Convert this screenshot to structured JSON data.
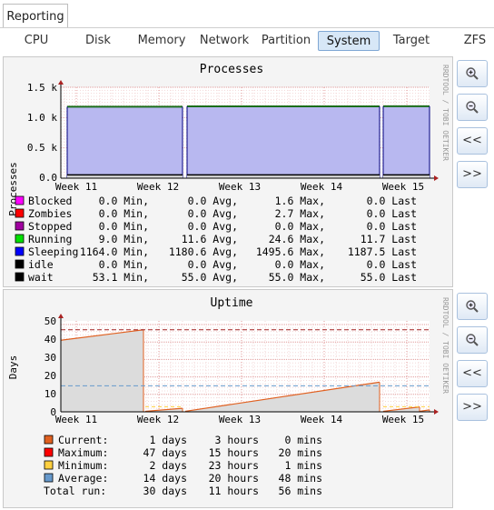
{
  "top_tab": "Reporting",
  "subtabs": [
    "CPU",
    "Disk",
    "Memory",
    "Network",
    "Partition",
    "System",
    "Target",
    "ZFS"
  ],
  "active_subtab": "System",
  "buttons": {
    "zoom_in_icon": "zoom-in-icon",
    "zoom_out_icon": "zoom-out-icon",
    "back": "<<",
    "forward": ">>"
  },
  "watermark": "RRDTOOL / TOBI OETIKER",
  "processes": {
    "title": "Processes",
    "ylabel": "Processes",
    "yticks": [
      "1.5 k",
      "1.0 k",
      "0.5 k",
      "0.0"
    ],
    "xticks": [
      "Week 11",
      "Week 12",
      "Week 13",
      "Week 14",
      "Week 15"
    ],
    "legend": [
      {
        "name": "Blocked",
        "color": "#ff00ff",
        "min": "0.0 Min,",
        "avg": "0.0 Avg,",
        "max": "1.6 Max,",
        "last": "0.0 Last"
      },
      {
        "name": "Zombies",
        "color": "#ff0000",
        "min": "0.0 Min,",
        "avg": "0.0 Avg,",
        "max": "2.7 Max,",
        "last": "0.0 Last"
      },
      {
        "name": "Stopped",
        "color": "#a000a0",
        "min": "0.0 Min,",
        "avg": "0.0 Avg,",
        "max": "0.0 Max,",
        "last": "0.0 Last"
      },
      {
        "name": "Running",
        "color": "#00e000",
        "min": "9.0 Min,",
        "avg": "11.6 Avg,",
        "max": "24.6 Max,",
        "last": "11.7 Last"
      },
      {
        "name": "Sleeping",
        "color": "#0000ff",
        "min": "1164.0 Min,",
        "avg": "1180.6 Avg,",
        "max": "1495.6 Max,",
        "last": "1187.5 Last"
      },
      {
        "name": "idle",
        "color": "#000000",
        "min": "0.0 Min,",
        "avg": "0.0 Avg,",
        "max": "0.0 Max,",
        "last": "0.0 Last"
      },
      {
        "name": "wait",
        "color": "#000000",
        "min": "53.1 Min,",
        "avg": "55.0 Avg,",
        "max": "55.0 Max,",
        "last": "55.0 Last"
      }
    ]
  },
  "uptime": {
    "title": "Uptime",
    "ylabel": "Days",
    "yticks": [
      "50",
      "40",
      "30",
      "20",
      "10",
      "0"
    ],
    "xticks": [
      "Week 11",
      "Week 12",
      "Week 13",
      "Week 14",
      "Week 15"
    ],
    "legend": [
      {
        "name": "Current:",
        "color": "#e06020",
        "d": "1 days",
        "h": "3 hours",
        "m": "0 mins"
      },
      {
        "name": "Maximum:",
        "color": "#ff0000",
        "d": "47 days",
        "h": "15 hours",
        "m": "20 mins"
      },
      {
        "name": "Minimum:",
        "color": "#ffd040",
        "d": "2 days",
        "h": "23 hours",
        "m": "1 mins"
      },
      {
        "name": "Average:",
        "color": "#6699cc",
        "d": "14 days",
        "h": "20 hours",
        "m": "48 mins"
      },
      {
        "name": "Total run:",
        "color": "",
        "d": "30 days",
        "h": "11 hours",
        "m": "56 mins"
      }
    ]
  },
  "chart_data": [
    {
      "type": "area",
      "title": "Processes",
      "ylabel": "Processes",
      "ylim": [
        0,
        1500
      ],
      "x": [
        "Week 11",
        "Week 12",
        "Week 13",
        "Week 14",
        "Week 15"
      ],
      "series": [
        {
          "name": "Sleeping",
          "values": [
            1180,
            1180,
            1185,
            1180,
            1187.5
          ]
        },
        {
          "name": "wait",
          "values": [
            55,
            55,
            55,
            55,
            55
          ]
        }
      ]
    },
    {
      "type": "area",
      "title": "Uptime",
      "ylabel": "Days",
      "ylim": [
        0,
        50
      ],
      "x": [
        "Week 11",
        "Week 12",
        "Week 13",
        "Week 14",
        "Week 15"
      ],
      "series": [
        {
          "name": "Current:",
          "values": [
            41,
            47,
            3,
            10,
            17
          ]
        },
        {
          "name": "Maximum:",
          "values": [
            47,
            47,
            47,
            47,
            47
          ]
        },
        {
          "name": "Average:",
          "values": [
            14.9,
            14.9,
            14.9,
            14.9,
            14.9
          ]
        }
      ]
    }
  ]
}
